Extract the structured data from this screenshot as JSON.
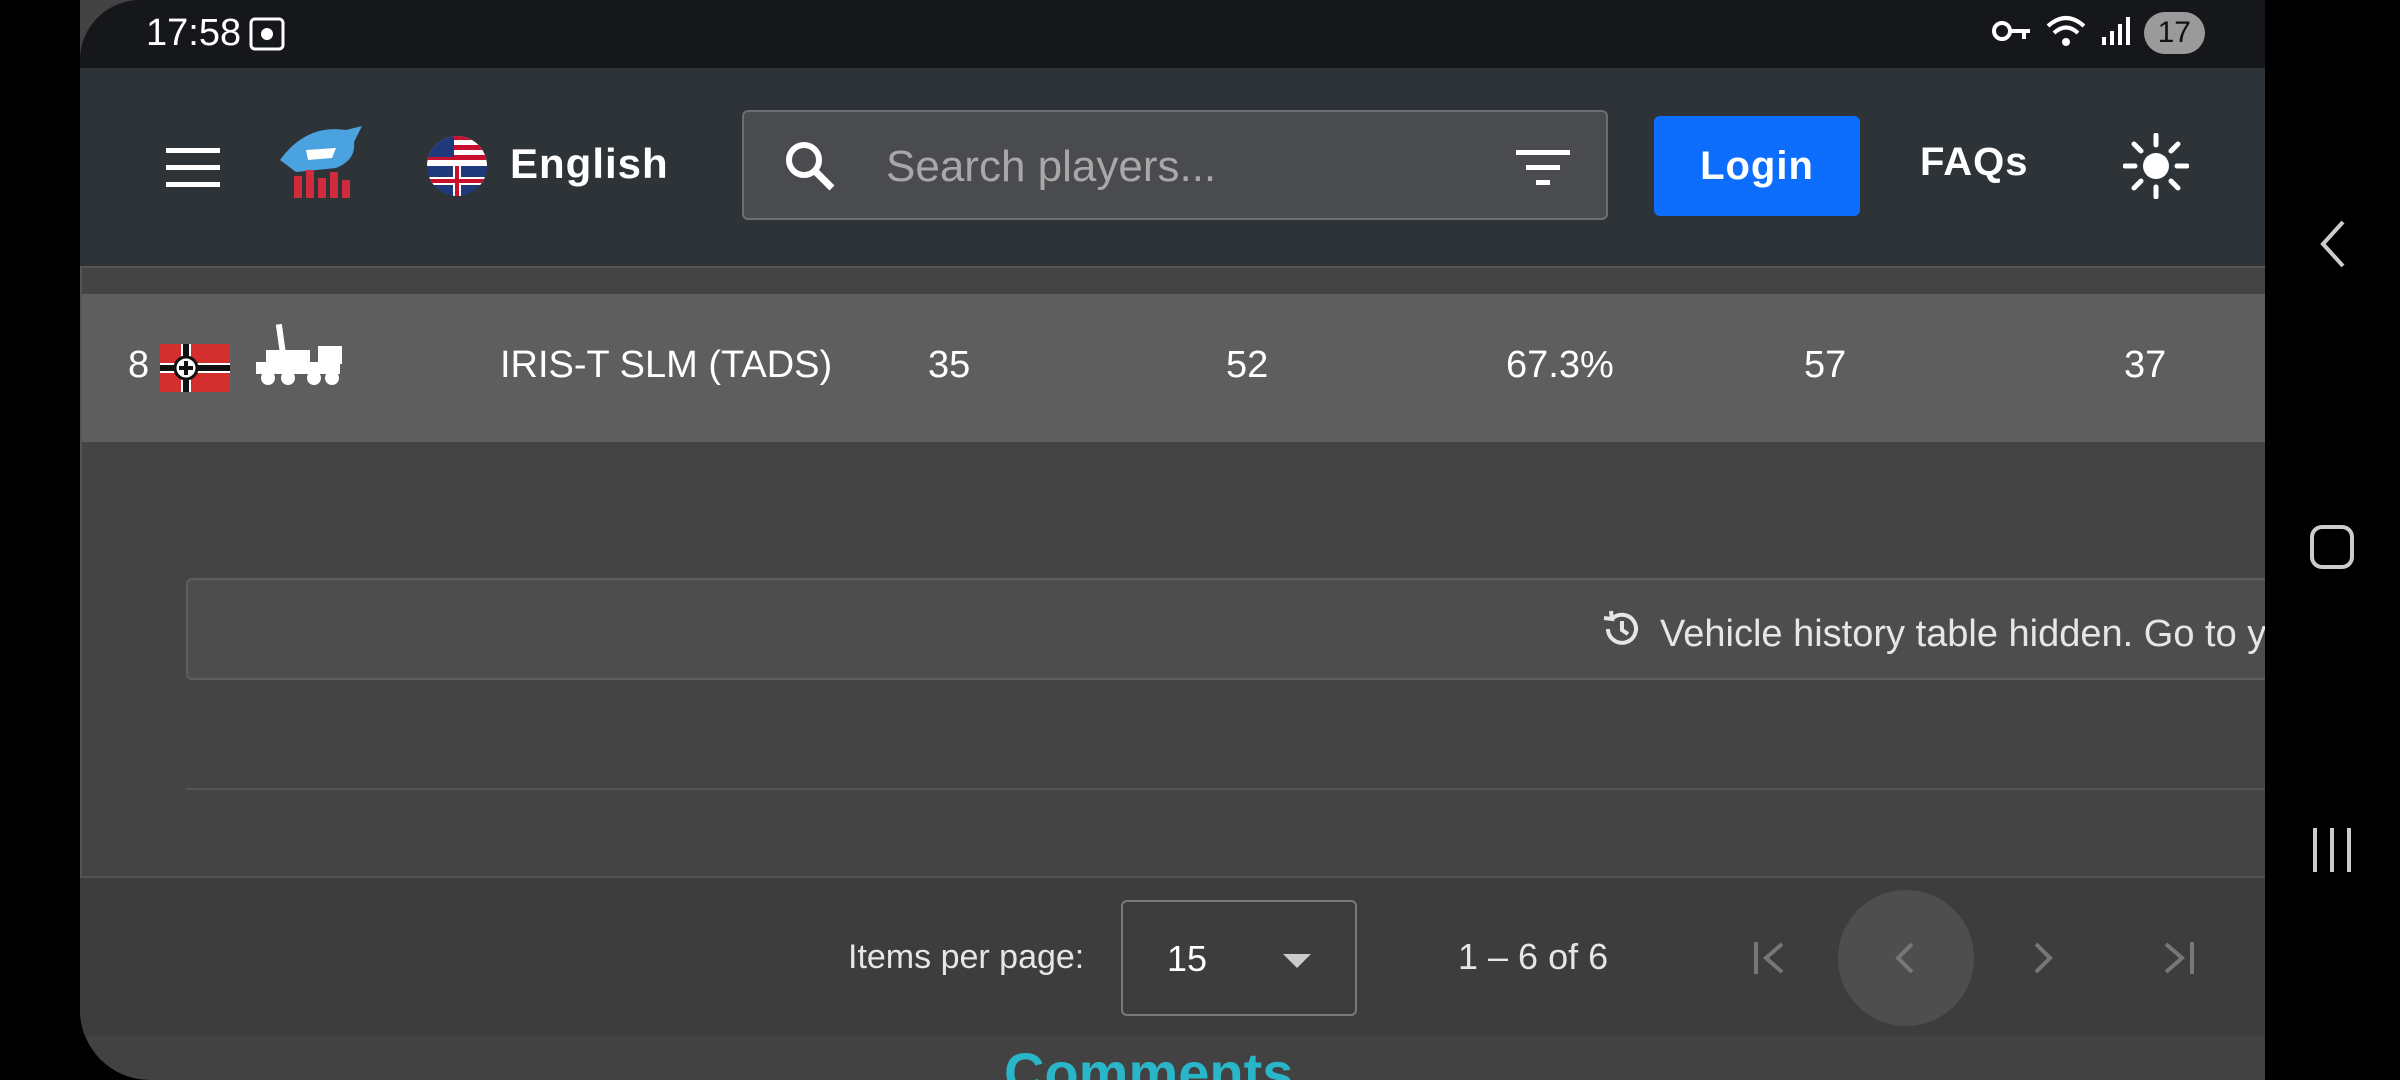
{
  "status_bar": {
    "time": "17:58",
    "battery": "17"
  },
  "navbar": {
    "language_label": "English",
    "search_placeholder": "Search players...",
    "login_label": "Login",
    "faqs_label": "FAQs"
  },
  "table": {
    "row": {
      "rank": "8",
      "vehicle_name": "IRIS-T SLM (TADS)",
      "col1": "35",
      "col2": "52",
      "col3": "67.3%",
      "col4": "57",
      "col5": "37"
    },
    "notice": "Vehicle history table hidden. Go to your"
  },
  "paginator": {
    "items_per_page_label": "Items per page:",
    "items_per_page_value": "15",
    "range_label": "1 – 6 of 6"
  },
  "comments_heading": "Comments",
  "colors": {
    "accent": "#0d6efd",
    "comments": "#29b6c8"
  }
}
